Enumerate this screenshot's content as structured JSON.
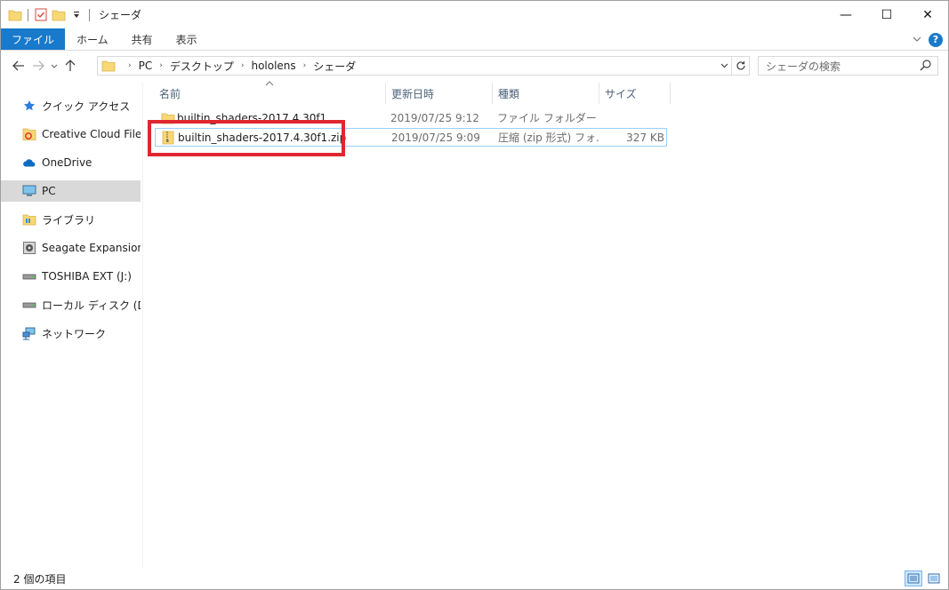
{
  "window": {
    "title": "シェーダ",
    "controls": {
      "minimize": "—",
      "maximize": "☐",
      "close": "✕"
    }
  },
  "ribbon": {
    "tabs": [
      "ファイル",
      "ホーム",
      "共有",
      "表示"
    ],
    "help": "?"
  },
  "address": {
    "crumbs": [
      "PC",
      "デスクトップ",
      "hololens",
      "シェーダ"
    ]
  },
  "search": {
    "placeholder": "シェーダの検索"
  },
  "nav_pane": {
    "items": [
      {
        "label": "クイック アクセス",
        "icon": "star-icon"
      },
      {
        "label": "Creative Cloud Files",
        "icon": "creative-cloud-folder-icon"
      },
      {
        "label": "OneDrive",
        "icon": "cloud-icon"
      },
      {
        "label": "PC",
        "icon": "computer-icon",
        "selected": true
      },
      {
        "label": "ライブラリ",
        "icon": "library-icon"
      },
      {
        "label": "Seagate Expansion Dr",
        "icon": "drive-icon"
      },
      {
        "label": "TOSHIBA EXT (J:)",
        "icon": "drive-icon"
      },
      {
        "label": "ローカル ディスク (D:)",
        "icon": "drive-icon"
      },
      {
        "label": "ネットワーク",
        "icon": "network-icon"
      }
    ]
  },
  "file_list": {
    "columns": {
      "name": "名前",
      "modified": "更新日時",
      "type": "種類",
      "size": "サイズ"
    },
    "rows": [
      {
        "name": "builtin_shaders-2017.4.30f1",
        "modified": "2019/07/25 9:12",
        "type": "ファイル フォルダー",
        "size": "",
        "icon": "folder-icon"
      },
      {
        "name": "builtin_shaders-2017.4.30f1.zip",
        "modified": "2019/07/25 9:09",
        "type": "圧縮 (zip 形式) フォ...",
        "size": "327 KB",
        "icon": "zip-folder-icon",
        "selected": true
      }
    ]
  },
  "status": {
    "item_count": "2 個の項目"
  },
  "colors": {
    "file_tab": "#1979ca",
    "selection_border": "#99d1ff",
    "highlight_annotation": "#e0262f",
    "nav_selected": "#d9d9d9"
  }
}
